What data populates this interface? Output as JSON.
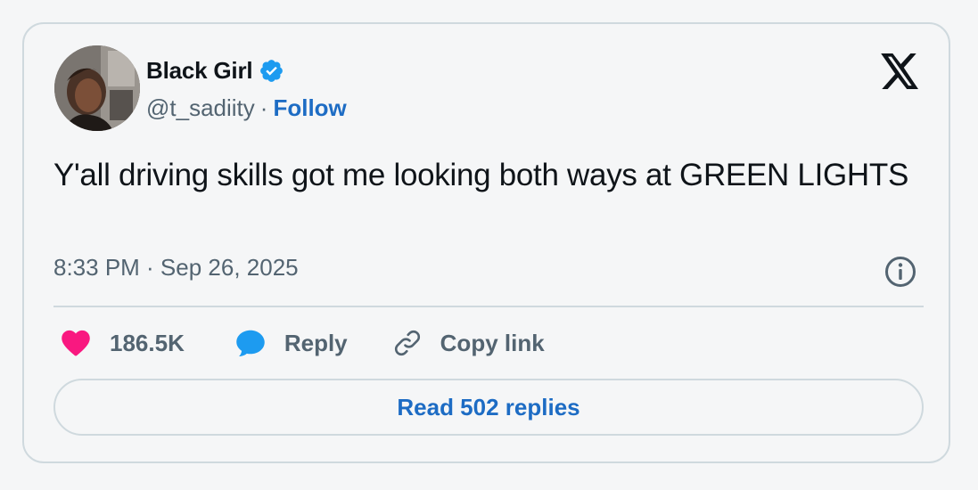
{
  "author": {
    "display_name": "Black Girl",
    "handle": "@t_sadiity",
    "separator": "·",
    "follow_label": "Follow",
    "verified": true
  },
  "tweet": {
    "text": "Y'all driving skills got me looking both ways at GREEN LIGHTS",
    "timestamp": "8:33 PM · Sep 26, 2025"
  },
  "actions": {
    "likes_count": "186.5K",
    "reply_label": "Reply",
    "copy_link_label": "Copy link",
    "read_replies_label": "Read 502 replies"
  },
  "icons": {
    "brand": "x-logo-icon",
    "verified": "verified-badge-icon",
    "info": "info-icon",
    "like": "heart-icon",
    "reply": "speech-bubble-icon",
    "copy_link": "link-icon"
  },
  "colors": {
    "accent": "#1d6cc4",
    "verified_blue": "#1d9bf0",
    "heart": "#f91880",
    "muted_text": "#536471",
    "border": "#cfd9de",
    "background": "#f5f6f7"
  }
}
